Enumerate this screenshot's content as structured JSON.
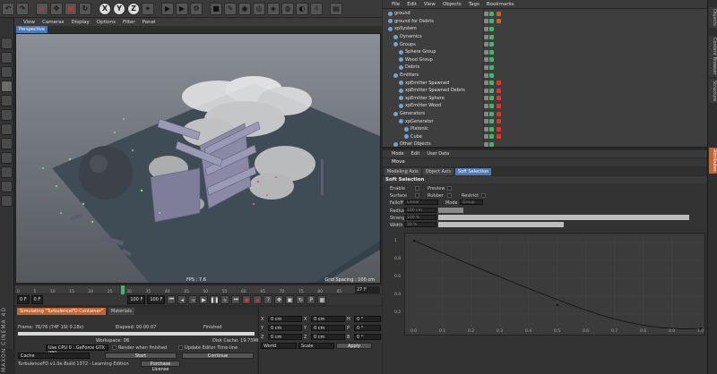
{
  "toolbar": {
    "axes": [
      "X",
      "Y",
      "Z"
    ]
  },
  "viewport": {
    "menu": [
      "View",
      "Cameras",
      "Display",
      "Options",
      "Filter",
      "Panel"
    ],
    "camera_label": "Perspective",
    "fps": "FPS : 7.6",
    "grid_spacing": "Grid Spacing : 100 cm"
  },
  "timeline": {
    "ticks": [
      "0",
      "5",
      "10",
      "15",
      "20",
      "25",
      "30",
      "35",
      "40",
      "45",
      "50",
      "55",
      "60",
      "65",
      "70",
      "75",
      "80",
      "85",
      "90",
      "95"
    ],
    "end_field": "27 F"
  },
  "transport": {
    "start": "0 F",
    "current": "0 F",
    "end": "100 F",
    "end2": "100 F"
  },
  "simulation": {
    "tabs": [
      "Simulating \"TurbulenceFD Container\"",
      "Materials"
    ],
    "frame": "Frame: 76/76 (74F 1St 0.18s)",
    "elapsed": "Elapsed: 00:00:07",
    "status": "Finished",
    "workspace": "Workspace: 0B",
    "disk_cache": "Disk Cache: 19.73MB",
    "gpu": "Use CPU 0 : GeForce GTX 980",
    "render_when_finished": "Render when finished",
    "update_editor": "Update Editor Time-line",
    "cache_label": "Cache",
    "start_button": "Start",
    "continue_button": "Continue",
    "build": "TurbulenceFD v1.0e Build 1372 - Learning Edition",
    "purchase_button": "Purchase License"
  },
  "coordinates": {
    "rows": [
      {
        "a": "X",
        "av": "0 cm",
        "b": "X",
        "bv": "0 cm",
        "c": "H",
        "cv": "0 °"
      },
      {
        "a": "Y",
        "av": "0 cm",
        "b": "Y",
        "bv": "0 cm",
        "c": "P",
        "cv": "0 °"
      },
      {
        "a": "Z",
        "av": "0 cm",
        "b": "Z",
        "bv": "0 cm",
        "c": "B",
        "cv": "0 °"
      }
    ],
    "mode": "World",
    "scale": "Scale",
    "apply": "Apply"
  },
  "object_manager": {
    "menu": [
      "File",
      "Edit",
      "View",
      "Objects",
      "Tags",
      "Bookmarks"
    ],
    "rows": [
      {
        "name": "ground",
        "indent": 0
      },
      {
        "name": "ground for Debris",
        "indent": 0
      },
      {
        "name": "xpSystem",
        "indent": 0
      },
      {
        "name": "Dynamics",
        "indent": 1
      },
      {
        "name": "Groups",
        "indent": 1
      },
      {
        "name": "Sphere Group",
        "indent": 2
      },
      {
        "name": "Wood Group",
        "indent": 2
      },
      {
        "name": "Debris",
        "indent": 2
      },
      {
        "name": "Emitters",
        "indent": 1
      },
      {
        "name": "xpEmitter Spawned",
        "indent": 2
      },
      {
        "name": "xpEmitter Spawned Debris",
        "indent": 2
      },
      {
        "name": "xpEmitter Sphere",
        "indent": 2
      },
      {
        "name": "xpEmitter Wood",
        "indent": 2
      },
      {
        "name": "Generators",
        "indent": 1
      },
      {
        "name": "xpGenerator",
        "indent": 2
      },
      {
        "name": "Platonic",
        "indent": 3
      },
      {
        "name": "Cube",
        "indent": 3
      },
      {
        "name": "Other Objects",
        "indent": 1
      }
    ]
  },
  "attribute_manager": {
    "menu": [
      "Mode",
      "Edit",
      "User Data"
    ],
    "title": "Move",
    "tabs": [
      "Modeling Axis",
      "Object Axis",
      "Soft Selection"
    ],
    "section": "Soft Selection",
    "enable": "Enable",
    "preview": "Preview",
    "surface": "Surface",
    "rubber": "Rubber",
    "restrict": "Restrict",
    "falloff": "Falloff",
    "falloff_value": "Linear",
    "mode": "Mode",
    "mode_value": "Group",
    "radius": "Radius",
    "radius_value": "100 cm",
    "strength": "Strength",
    "strength_value": "100 %",
    "width": "Width",
    "width_value": "50 %",
    "strength_fill": 1.0,
    "width_fill": 0.5,
    "graph_y_ticks": [
      "1",
      "0.8",
      "0.6",
      "0.4",
      "0.2"
    ],
    "graph_x_ticks": [
      "0.0",
      "0.1",
      "0.2",
      "0.3",
      "0.4",
      "0.5",
      "0.6",
      "0.7",
      "0.8",
      "0.9",
      "1.0"
    ]
  },
  "right_strip": {
    "tabs": [
      "Objects",
      "Content Browser",
      "Structure",
      "Attributes"
    ]
  }
}
